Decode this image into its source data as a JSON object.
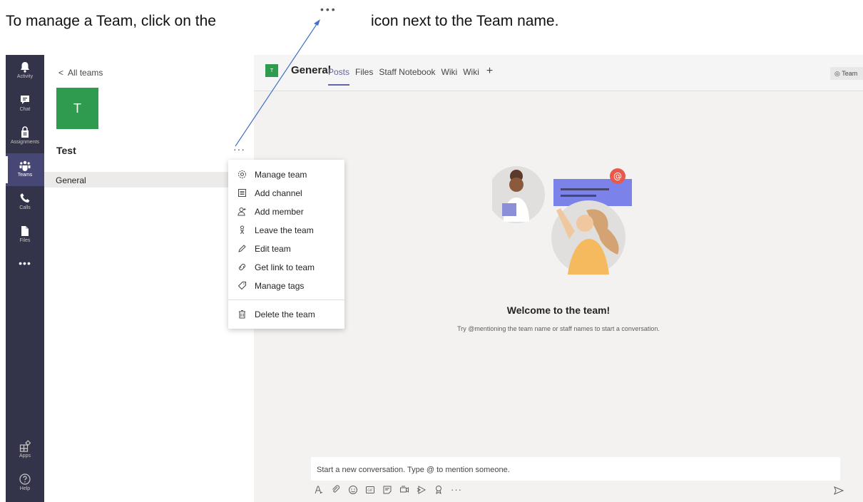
{
  "instruction": {
    "part1": "To manage a Team, click on the",
    "dots": "•••",
    "part2": "icon next to the Team name."
  },
  "rail": {
    "items": [
      {
        "label": "Activity",
        "icon": "bell-icon"
      },
      {
        "label": "Chat",
        "icon": "chat-icon"
      },
      {
        "label": "Assignments",
        "icon": "assignments-icon"
      },
      {
        "label": "Teams",
        "icon": "teams-icon",
        "active": true
      },
      {
        "label": "Calls",
        "icon": "phone-icon"
      },
      {
        "label": "Files",
        "icon": "files-icon"
      }
    ],
    "more": "•••",
    "bottom": [
      {
        "label": "Apps",
        "icon": "apps-icon"
      },
      {
        "label": "Help",
        "icon": "help-icon"
      }
    ]
  },
  "teams_pane": {
    "back_label": "All teams",
    "team_initial": "T",
    "team_name": "Test",
    "more_options": "···",
    "channel": "General"
  },
  "menu": {
    "items": [
      {
        "label": "Manage team",
        "icon": "gear-icon"
      },
      {
        "label": "Add channel",
        "icon": "add-channel-icon"
      },
      {
        "label": "Add member",
        "icon": "add-member-icon"
      },
      {
        "label": "Leave the team",
        "icon": "leave-icon"
      },
      {
        "label": "Edit team",
        "icon": "pencil-icon"
      },
      {
        "label": "Get link to team",
        "icon": "link-icon"
      },
      {
        "label": "Manage tags",
        "icon": "tag-icon"
      },
      {
        "label": "Delete the team",
        "icon": "trash-icon"
      }
    ]
  },
  "channel_header": {
    "initial": "T",
    "title": "General",
    "tabs": [
      "Posts",
      "Files",
      "Staff Notebook",
      "Wiki",
      "Wiki"
    ],
    "active_tab": "Posts",
    "add_tab": "+",
    "team_button": "◎ Team"
  },
  "welcome": {
    "title": "Welcome to the team!",
    "subtitle": "Try @mentioning the team name or staff names to start a conversation."
  },
  "compose": {
    "placeholder": "Start a new conversation. Type @ to mention someone.",
    "more": "···"
  },
  "colors": {
    "rail": "#33344a",
    "rail_active": "#464775",
    "accent": "#6264a7",
    "team_tile": "#2e9b4e",
    "mention_badge": "#e8594a"
  }
}
